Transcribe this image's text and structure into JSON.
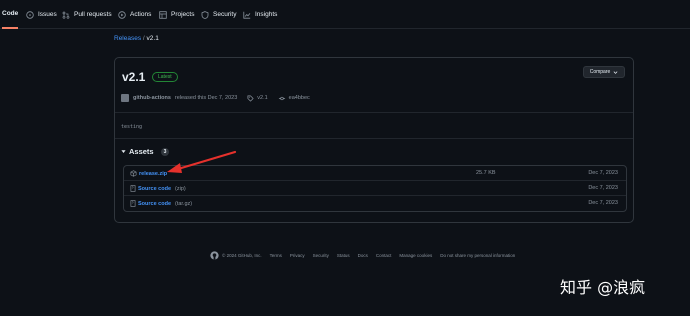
{
  "nav": {
    "tabs": [
      {
        "label": "Code",
        "icon": "code-icon"
      },
      {
        "label": "Issues",
        "icon": "issue-icon"
      },
      {
        "label": "Pull requests",
        "icon": "pull-request-icon"
      },
      {
        "label": "Actions",
        "icon": "play-icon"
      },
      {
        "label": "Projects",
        "icon": "table-icon"
      },
      {
        "label": "Security",
        "icon": "shield-icon"
      },
      {
        "label": "Insights",
        "icon": "graph-icon"
      }
    ]
  },
  "breadcrumb": {
    "parent": "Releases",
    "separator": "/",
    "current": "v2.1"
  },
  "release": {
    "title": "v2.1",
    "badge": "Latest",
    "compare_label": "Compare",
    "author": "github-actions",
    "released_text": "released this Dec 7, 2023",
    "tag": "v2.1",
    "commit": "ea4bbec",
    "description": "testing"
  },
  "assets": {
    "title": "Assets",
    "count": "3",
    "items": [
      {
        "name": "release.zip",
        "sub": "",
        "size": "25.7 KB",
        "date": "Dec 7, 2023",
        "icon": "package-icon"
      },
      {
        "name": "Source code",
        "sub": "(zip)",
        "size": "",
        "date": "Dec 7, 2023",
        "icon": "file-zip-icon"
      },
      {
        "name": "Source code",
        "sub": "(tar.gz)",
        "size": "",
        "date": "Dec 7, 2023",
        "icon": "file-zip-icon"
      }
    ]
  },
  "footer": {
    "copyright": "© 2024 GitHub, Inc.",
    "links": [
      "Terms",
      "Privacy",
      "Security",
      "Status",
      "Docs",
      "Contact",
      "Manage cookies",
      "Do not share my personal information"
    ]
  },
  "watermark": "知乎 @浪疯",
  "colors": {
    "accent": "#4493f8",
    "badge": "#3fb950",
    "arrow": "#e5312c",
    "tab_underline": "#f78166"
  }
}
